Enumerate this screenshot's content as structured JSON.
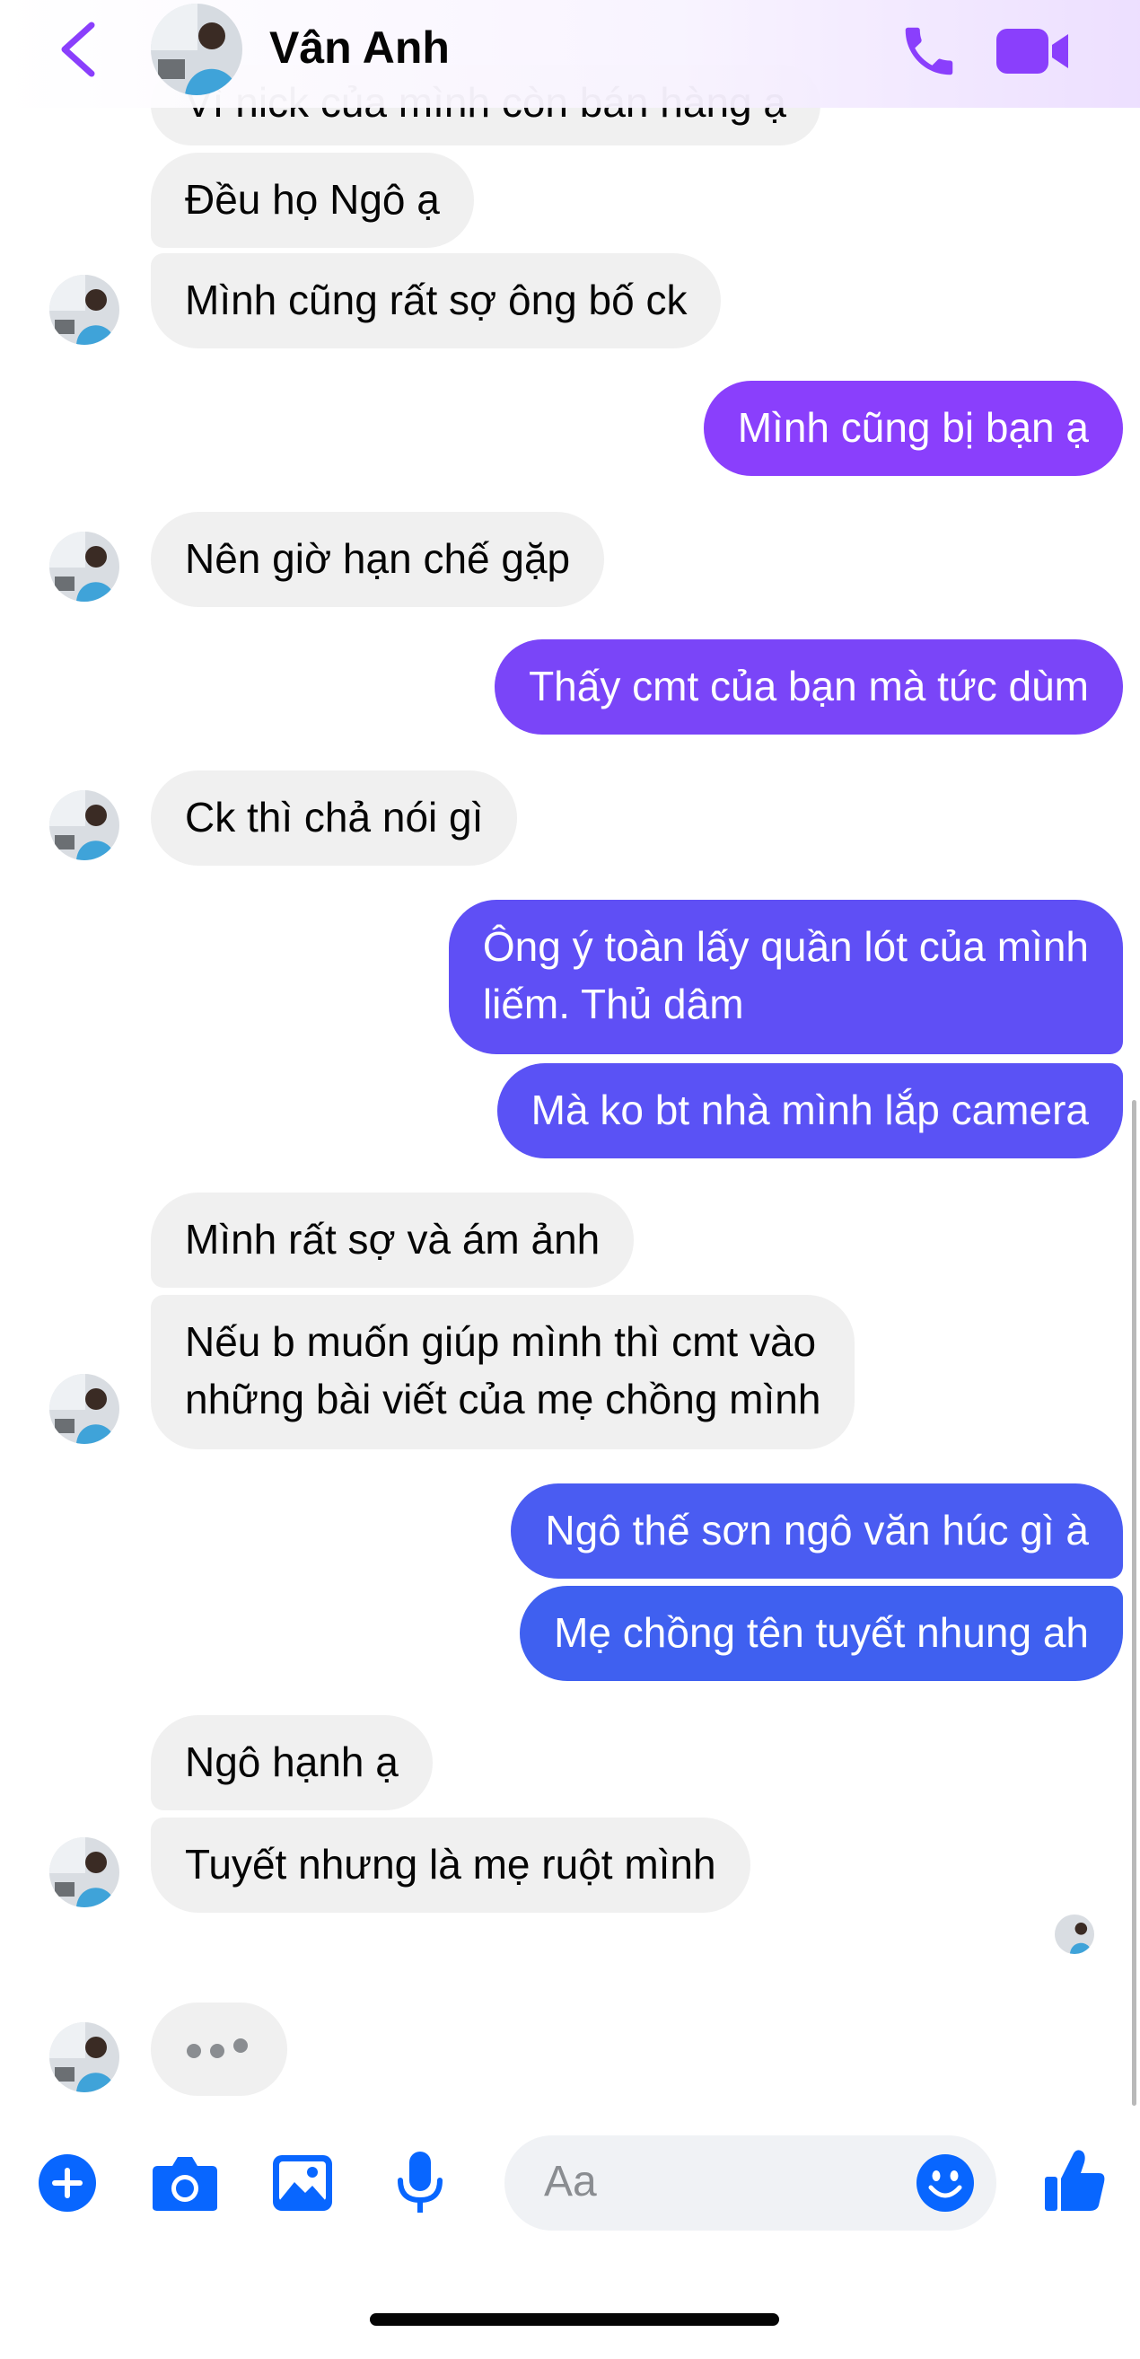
{
  "header": {
    "title": "Vân Anh",
    "back_icon": "chevron-left-icon",
    "call_icon": "phone-icon",
    "video_icon": "video-camera-icon",
    "accent_color": "#8a3ffc"
  },
  "messages": [
    {
      "side": "received",
      "text": "Vì nick của mình còn bán hàng ạ"
    },
    {
      "side": "received",
      "text": "Đều họ Ngô ạ"
    },
    {
      "side": "received",
      "text": "Mình cũng rất sợ ông bố ck"
    },
    {
      "side": "sent",
      "text": "Mình cũng bị bạn ạ"
    },
    {
      "side": "received",
      "text": "Nên giờ hạn chế gặp"
    },
    {
      "side": "sent",
      "text": "Thấy cmt của bạn mà tức dùm"
    },
    {
      "side": "received",
      "text": "Ck thì chả nói gì"
    },
    {
      "side": "sent",
      "lines": [
        "Ông ý toàn lấy quần lót của mình",
        "liếm. Thủ dâm"
      ]
    },
    {
      "side": "sent",
      "text": "Mà ko bt nhà mình lắp camera"
    },
    {
      "side": "received",
      "text": "Mình rất sợ và ám ảnh"
    },
    {
      "side": "received",
      "lines": [
        "Nếu b muốn giúp mình thì cmt vào",
        "những bài viết của mẹ chồng mình"
      ]
    },
    {
      "side": "sent",
      "text": "Ngô thế sơn ngô văn húc gì à"
    },
    {
      "side": "sent",
      "text": "Mẹ chồng tên tuyết nhung ah"
    },
    {
      "side": "received",
      "text": "Ngô hạnh ạ"
    },
    {
      "side": "received",
      "text": "Tuyết nhưng là mẹ ruột mình"
    }
  ],
  "composer": {
    "placeholder": "Aa",
    "icons": [
      "plus-icon",
      "camera-icon",
      "gallery-icon",
      "microphone-icon",
      "emoji-icon",
      "thumbs-up-icon"
    ],
    "color": "#0866ff"
  },
  "colors": {
    "received_bubble": "#f0f0f0",
    "sent_purple": "#8a3ffc",
    "sent_indigo": "#5b51f6",
    "sent_blue": "#3f5ff0"
  }
}
